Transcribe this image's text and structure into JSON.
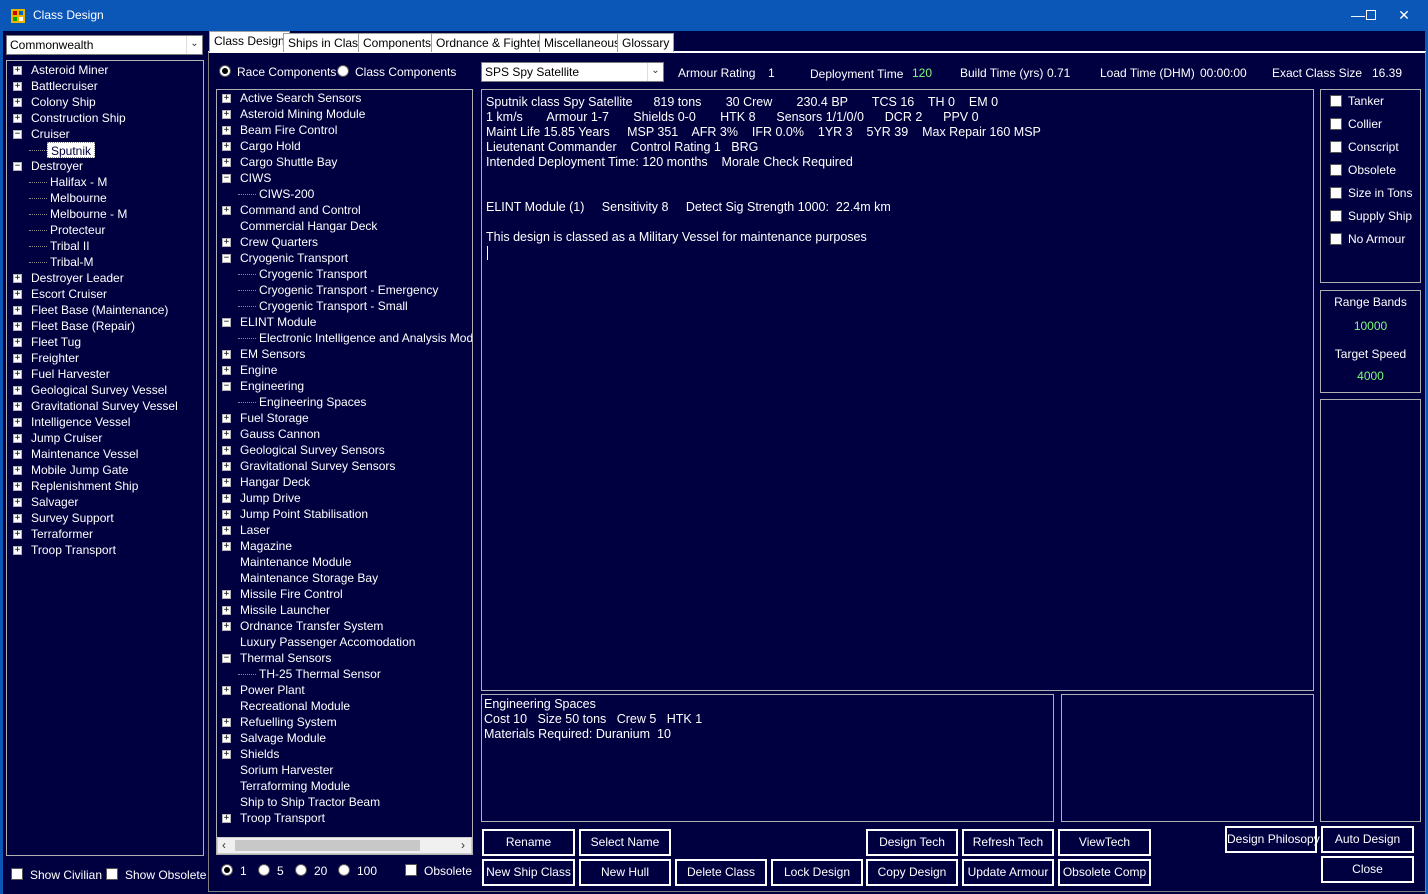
{
  "window": {
    "title": "Class Design"
  },
  "race_select": {
    "value": "Commonwealth"
  },
  "class_tree": [
    {
      "label": "Asteroid Miner",
      "expand": "+",
      "indent": 0
    },
    {
      "label": "Battlecruiser",
      "expand": "+",
      "indent": 0
    },
    {
      "label": "Colony Ship",
      "expand": "+",
      "indent": 0
    },
    {
      "label": "Construction Ship",
      "expand": "+",
      "indent": 0
    },
    {
      "label": "Cruiser",
      "expand": "-",
      "indent": 0
    },
    {
      "label": "Sputnik",
      "expand": "",
      "indent": 1,
      "selected": true
    },
    {
      "label": "Destroyer",
      "expand": "-",
      "indent": 0
    },
    {
      "label": "Halifax - M",
      "expand": "",
      "indent": 1
    },
    {
      "label": "Melbourne",
      "expand": "",
      "indent": 1
    },
    {
      "label": "Melbourne - M",
      "expand": "",
      "indent": 1
    },
    {
      "label": "Protecteur",
      "expand": "",
      "indent": 1
    },
    {
      "label": "Tribal II",
      "expand": "",
      "indent": 1
    },
    {
      "label": "Tribal-M",
      "expand": "",
      "indent": 1
    },
    {
      "label": "Destroyer Leader",
      "expand": "+",
      "indent": 0
    },
    {
      "label": "Escort Cruiser",
      "expand": "+",
      "indent": 0
    },
    {
      "label": "Fleet Base (Maintenance)",
      "expand": "+",
      "indent": 0
    },
    {
      "label": "Fleet Base (Repair)",
      "expand": "+",
      "indent": 0
    },
    {
      "label": "Fleet Tug",
      "expand": "+",
      "indent": 0
    },
    {
      "label": "Freighter",
      "expand": "+",
      "indent": 0
    },
    {
      "label": "Fuel Harvester",
      "expand": "+",
      "indent": 0
    },
    {
      "label": "Geological Survey Vessel",
      "expand": "+",
      "indent": 0
    },
    {
      "label": "Gravitational Survey Vessel",
      "expand": "+",
      "indent": 0
    },
    {
      "label": "Intelligence Vessel",
      "expand": "+",
      "indent": 0
    },
    {
      "label": "Jump Cruiser",
      "expand": "+",
      "indent": 0
    },
    {
      "label": "Maintenance Vessel",
      "expand": "+",
      "indent": 0
    },
    {
      "label": "Mobile Jump Gate",
      "expand": "+",
      "indent": 0
    },
    {
      "label": "Replenishment Ship",
      "expand": "+",
      "indent": 0
    },
    {
      "label": "Salvager",
      "expand": "+",
      "indent": 0
    },
    {
      "label": "Survey Support",
      "expand": "+",
      "indent": 0
    },
    {
      "label": "Terraformer",
      "expand": "+",
      "indent": 0
    },
    {
      "label": "Troop Transport",
      "expand": "+",
      "indent": 0
    }
  ],
  "left_bottom": {
    "show_civilian": "Show Civilian",
    "show_obsolete": "Show Obsolete"
  },
  "tabs": [
    "Class Design",
    "Ships in Class",
    "Components",
    "Ordnance & Fighters",
    "Miscellaneous",
    "Glossary"
  ],
  "component_source": {
    "race": "Race Components",
    "class": "Class Components"
  },
  "hull_select": {
    "value": "SPS Spy Satellite"
  },
  "stats": {
    "armour_label": "Armour Rating",
    "armour_value": "1",
    "deploy_label": "Deployment Time",
    "deploy_value": "120",
    "build_label": "Build Time (yrs)",
    "build_value": "0.71",
    "load_label": "Load Time (DHM)",
    "load_value": "00:00:00",
    "size_label": "Exact Class Size",
    "size_value": "16.39"
  },
  "component_tree": [
    {
      "label": "Active Search Sensors",
      "expand": "+",
      "indent": 0
    },
    {
      "label": "Asteroid Mining Module",
      "expand": "+",
      "indent": 0
    },
    {
      "label": "Beam Fire Control",
      "expand": "+",
      "indent": 0
    },
    {
      "label": "Cargo Hold",
      "expand": "+",
      "indent": 0
    },
    {
      "label": "Cargo Shuttle Bay",
      "expand": "+",
      "indent": 0
    },
    {
      "label": "CIWS",
      "expand": "-",
      "indent": 0
    },
    {
      "label": "CIWS-200",
      "expand": "",
      "indent": 1
    },
    {
      "label": "Command and Control",
      "expand": "+",
      "indent": 0
    },
    {
      "label": "Commercial Hangar Deck",
      "expand": "",
      "indent": 0
    },
    {
      "label": "Crew Quarters",
      "expand": "+",
      "indent": 0
    },
    {
      "label": "Cryogenic Transport",
      "expand": "-",
      "indent": 0
    },
    {
      "label": "Cryogenic Transport",
      "expand": "",
      "indent": 1
    },
    {
      "label": "Cryogenic Transport - Emergency",
      "expand": "",
      "indent": 1
    },
    {
      "label": "Cryogenic Transport - Small",
      "expand": "",
      "indent": 1
    },
    {
      "label": "ELINT Module",
      "expand": "-",
      "indent": 0
    },
    {
      "label": "Electronic Intelligence and Analysis Module -",
      "expand": "",
      "indent": 1
    },
    {
      "label": "EM Sensors",
      "expand": "+",
      "indent": 0
    },
    {
      "label": "Engine",
      "expand": "+",
      "indent": 0
    },
    {
      "label": "Engineering",
      "expand": "-",
      "indent": 0
    },
    {
      "label": "Engineering Spaces",
      "expand": "",
      "indent": 1
    },
    {
      "label": "Fuel Storage",
      "expand": "+",
      "indent": 0
    },
    {
      "label": "Gauss Cannon",
      "expand": "+",
      "indent": 0
    },
    {
      "label": "Geological Survey Sensors",
      "expand": "+",
      "indent": 0
    },
    {
      "label": "Gravitational Survey Sensors",
      "expand": "+",
      "indent": 0
    },
    {
      "label": "Hangar Deck",
      "expand": "+",
      "indent": 0
    },
    {
      "label": "Jump Drive",
      "expand": "+",
      "indent": 0
    },
    {
      "label": "Jump Point Stabilisation",
      "expand": "+",
      "indent": 0
    },
    {
      "label": "Laser",
      "expand": "+",
      "indent": 0
    },
    {
      "label": "Magazine",
      "expand": "+",
      "indent": 0
    },
    {
      "label": "Maintenance Module",
      "expand": "",
      "indent": 0
    },
    {
      "label": "Maintenance Storage Bay",
      "expand": "",
      "indent": 0
    },
    {
      "label": "Missile Fire Control",
      "expand": "+",
      "indent": 0
    },
    {
      "label": "Missile Launcher",
      "expand": "+",
      "indent": 0
    },
    {
      "label": "Ordnance Transfer System",
      "expand": "+",
      "indent": 0
    },
    {
      "label": "Luxury Passenger Accomodation",
      "expand": "",
      "indent": 0
    },
    {
      "label": "Thermal Sensors",
      "expand": "-",
      "indent": 0
    },
    {
      "label": "TH-25 Thermal Sensor",
      "expand": "",
      "indent": 1
    },
    {
      "label": "Power Plant",
      "expand": "+",
      "indent": 0
    },
    {
      "label": "Recreational Module",
      "expand": "",
      "indent": 0
    },
    {
      "label": "Refuelling System",
      "expand": "+",
      "indent": 0
    },
    {
      "label": "Salvage Module",
      "expand": "+",
      "indent": 0
    },
    {
      "label": "Shields",
      "expand": "+",
      "indent": 0
    },
    {
      "label": "Sorium Harvester",
      "expand": "",
      "indent": 0
    },
    {
      "label": "Terraforming Module",
      "expand": "",
      "indent": 0
    },
    {
      "label": "Ship to Ship Tractor Beam",
      "expand": "",
      "indent": 0
    },
    {
      "label": "Troop Transport",
      "expand": "+",
      "indent": 0
    }
  ],
  "quantity": {
    "q1": "1",
    "q5": "5",
    "q20": "20",
    "q100": "100",
    "obsolete": "Obsolete"
  },
  "design_summary": [
    "Sputnik class Spy Satellite      819 tons       30 Crew       230.4 BP       TCS 16    TH 0    EM 0",
    "1 km/s       Armour 1-7       Shields 0-0       HTK 8      Sensors 1/1/0/0      DCR 2      PPV 0",
    "Maint Life 15.85 Years     MSP 351    AFR 3%    IFR 0.0%    1YR 3    5YR 39    Max Repair 160 MSP",
    "Lieutenant Commander    Control Rating 1   BRG",
    "Intended Deployment Time: 120 months    Morale Check Required",
    "",
    "",
    "ELINT Module (1)     Sensitivity 8     Detect Sig Strength 1000:  22.4m km",
    "",
    "This design is classed as a Military Vessel for maintenance purposes"
  ],
  "component_info": [
    "Engineering Spaces",
    "Cost 10   Size 50 tons   Crew 5   HTK 1",
    "Materials Required: Duranium  10"
  ],
  "flags": [
    "Tanker",
    "Collier",
    "Conscript",
    "Obsolete",
    "Size in Tons",
    "Supply Ship",
    "No Armour"
  ],
  "range": {
    "bands_label": "Range Bands",
    "bands_value": "10000",
    "speed_label": "Target Speed",
    "speed_value": "4000"
  },
  "buttons": {
    "rename": "Rename",
    "select_name": "Select Name",
    "design_tech": "Design Tech",
    "refresh_tech": "Refresh Tech",
    "view_tech": "ViewTech",
    "design_philosophy": "Design Philosopy",
    "auto_design": "Auto Design",
    "new_class": "New Ship Class",
    "new_hull": "New Hull",
    "delete_class": "Delete Class",
    "lock_design": "Lock Design",
    "copy_design": "Copy Design",
    "update_armour": "Update Armour",
    "obsolete_comp": "Obsolete Comp",
    "close": "Close"
  },
  "colors": {
    "background": "#000040",
    "titlebar": "#0b57b8",
    "value_green": "#7dfc7d"
  }
}
